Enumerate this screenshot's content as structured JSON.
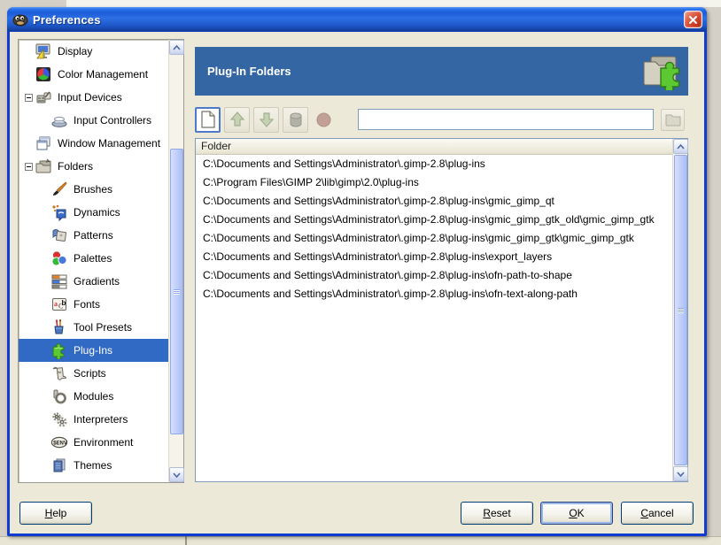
{
  "window": {
    "title": "Preferences",
    "icon": "gimp-wilber-icon",
    "close": "close-button"
  },
  "sidebar": {
    "items": [
      {
        "label": "Display",
        "icon": "display-icon",
        "level": 1,
        "expander": null,
        "selected": false
      },
      {
        "label": "Color Management",
        "icon": "color-management-icon",
        "level": 1,
        "expander": null,
        "selected": false
      },
      {
        "label": "Input Devices",
        "icon": "input-devices-icon",
        "level": 1,
        "expander": "collapse",
        "selected": false
      },
      {
        "label": "Input Controllers",
        "icon": "input-controllers-icon",
        "level": 2,
        "expander": null,
        "selected": false
      },
      {
        "label": "Window Management",
        "icon": "window-management-icon",
        "level": 1,
        "expander": null,
        "selected": false
      },
      {
        "label": "Folders",
        "icon": "folders-icon",
        "level": 1,
        "expander": "collapse",
        "selected": false
      },
      {
        "label": "Brushes",
        "icon": "brushes-icon",
        "level": 2,
        "expander": null,
        "selected": false
      },
      {
        "label": "Dynamics",
        "icon": "dynamics-icon",
        "level": 2,
        "expander": null,
        "selected": false
      },
      {
        "label": "Patterns",
        "icon": "patterns-icon",
        "level": 2,
        "expander": null,
        "selected": false
      },
      {
        "label": "Palettes",
        "icon": "palettes-icon",
        "level": 2,
        "expander": null,
        "selected": false
      },
      {
        "label": "Gradients",
        "icon": "gradients-icon",
        "level": 2,
        "expander": null,
        "selected": false
      },
      {
        "label": "Fonts",
        "icon": "fonts-icon",
        "level": 2,
        "expander": null,
        "selected": false
      },
      {
        "label": "Tool Presets",
        "icon": "tool-presets-icon",
        "level": 2,
        "expander": null,
        "selected": false
      },
      {
        "label": "Plug-Ins",
        "icon": "plug-ins-icon",
        "level": 2,
        "expander": null,
        "selected": true
      },
      {
        "label": "Scripts",
        "icon": "scripts-icon",
        "level": 2,
        "expander": null,
        "selected": false
      },
      {
        "label": "Modules",
        "icon": "modules-icon",
        "level": 2,
        "expander": null,
        "selected": false
      },
      {
        "label": "Interpreters",
        "icon": "interpreters-icon",
        "level": 2,
        "expander": null,
        "selected": false
      },
      {
        "label": "Environment",
        "icon": "environment-icon",
        "level": 2,
        "expander": null,
        "selected": false
      },
      {
        "label": "Themes",
        "icon": "themes-icon",
        "level": 2,
        "expander": null,
        "selected": false
      }
    ]
  },
  "header": {
    "title": "Plug-In Folders",
    "icon": "folder-plugin-icon"
  },
  "toolbar": {
    "buttons": [
      {
        "name": "add-new-folder",
        "icon": "new-document-icon",
        "enabled": true,
        "focused": true
      },
      {
        "name": "move-up",
        "icon": "arrow-up-icon",
        "enabled": false,
        "focused": false
      },
      {
        "name": "move-down",
        "icon": "arrow-down-icon",
        "enabled": false,
        "focused": false
      },
      {
        "name": "delete-folder",
        "icon": "delete-icon",
        "enabled": false,
        "focused": false
      },
      {
        "name": "writable-indicator",
        "icon": "red-circle-icon",
        "enabled": false,
        "focused": false
      }
    ],
    "entry_value": "",
    "browse": {
      "name": "browse-folder",
      "icon": "folder-browse-icon",
      "enabled": false
    }
  },
  "folder_list": {
    "column_header": "Folder",
    "items": [
      "C:\\Documents and Settings\\Administrator\\.gimp-2.8\\plug-ins",
      "C:\\Program Files\\GIMP 2\\lib\\gimp\\2.0\\plug-ins",
      "C:\\Documents and Settings\\Administrator\\.gimp-2.8\\plug-ins\\gmic_gimp_qt",
      "C:\\Documents and Settings\\Administrator\\.gimp-2.8\\plug-ins\\gmic_gimp_gtk_old\\gmic_gimp_gtk",
      "C:\\Documents and Settings\\Administrator\\.gimp-2.8\\plug-ins\\gmic_gimp_gtk\\gmic_gimp_gtk",
      "C:\\Documents and Settings\\Administrator\\.gimp-2.8\\plug-ins\\export_layers",
      "C:\\Documents and Settings\\Administrator\\.gimp-2.8\\plug-ins\\ofn-path-to-shape",
      "C:\\Documents and Settings\\Administrator\\.gimp-2.8\\plug-ins\\ofn-text-along-path"
    ]
  },
  "footer": {
    "help": "Help",
    "reset": "Reset",
    "ok": "OK",
    "cancel": "Cancel"
  },
  "colors": {
    "titlebar_blue": "#1e56c8",
    "window_border": "#0f3bd0",
    "dialog_face": "#ece9d8",
    "banner_blue": "#3566a4",
    "selection_blue": "#316ac5",
    "close_red": "#cc3a24",
    "scrollbar_thumb": "#c0cffa"
  }
}
